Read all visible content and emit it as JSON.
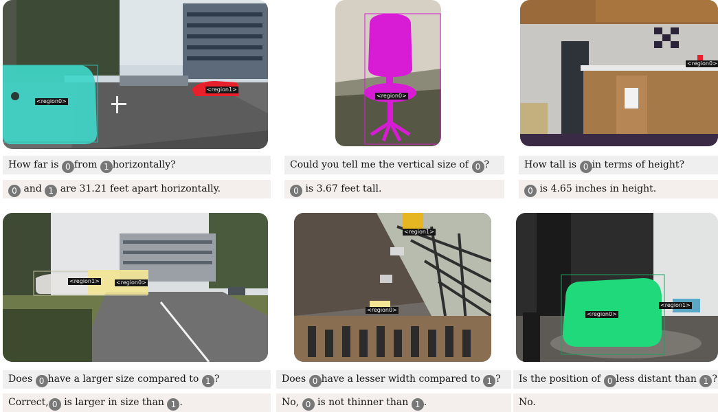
{
  "badges": {
    "zero": "0",
    "one": "1"
  },
  "panels": [
    {
      "regions": [
        "<region0>",
        "<region1>"
      ],
      "question": [
        "How far is",
        "from",
        "horizontally?"
      ],
      "answer": [
        "and",
        "are 31.21 feet apart horizontally."
      ]
    },
    {
      "regions": [
        "<region0>"
      ],
      "question": [
        "Could you tell me the vertical size of",
        "?"
      ],
      "answer": [
        "is 3.67 feet tall."
      ]
    },
    {
      "regions": [
        "<region0>"
      ],
      "question": [
        "How tall is",
        "in terms of height?"
      ],
      "answer": [
        "is 4.65 inches in height."
      ]
    },
    {
      "regions": [
        "<region1>",
        "<region0>"
      ],
      "question": [
        "Does",
        "have a larger size compared to",
        "?"
      ],
      "answer": [
        "Correct,",
        "is larger in size than",
        "."
      ]
    },
    {
      "regions": [
        "<region1>",
        "<region0>"
      ],
      "question": [
        "Does",
        "have a lesser width compared to",
        "?"
      ],
      "answer": [
        "No,",
        "is not thinner than",
        "."
      ]
    },
    {
      "regions": [
        "<region0>",
        "<region1>"
      ],
      "question": [
        "Is the position of",
        "less distant than",
        "?"
      ],
      "answer": [
        "No."
      ]
    }
  ],
  "colors": {
    "cyan": "#3fd6c8",
    "red": "#e8202c",
    "magenta": "#d81bd4",
    "yellow": "#f2e596",
    "amber": "#e6b522",
    "green": "#1fd97a"
  }
}
